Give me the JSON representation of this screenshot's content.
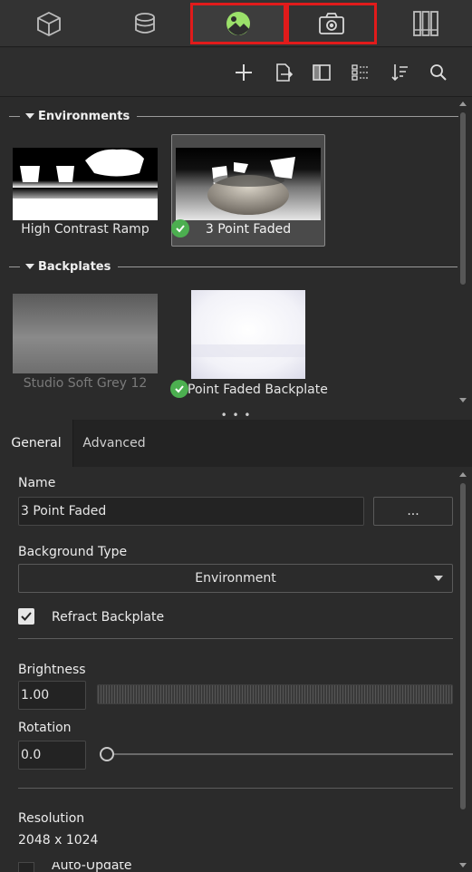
{
  "top_tabs": [
    {
      "icon": "cube-icon"
    },
    {
      "icon": "material-ball-icon"
    },
    {
      "icon": "environment-icon",
      "active": true
    },
    {
      "icon": "camera-icon"
    },
    {
      "icon": "library-books-icon"
    }
  ],
  "toolbar": {
    "icons": [
      "plus-icon",
      "import-file-icon",
      "split-view-icon",
      "grid-view-icon",
      "sort-icon",
      "search-icon"
    ]
  },
  "library": {
    "environments": {
      "header": "Environments",
      "items": [
        {
          "label": "High Contrast Ramp",
          "selected": false,
          "active": false
        },
        {
          "label": "3 Point Faded",
          "selected": true,
          "active": true
        }
      ]
    },
    "backplates": {
      "header": "Backplates",
      "items": [
        {
          "label": "Studio Soft Grey 12",
          "dimmed": true,
          "active": false
        },
        {
          "label": "Point Faded Backplate",
          "dimmed": false,
          "active": true
        }
      ]
    }
  },
  "splitter": {
    "glyph": "• • •"
  },
  "properties": {
    "tabs": [
      {
        "label": "General",
        "active": true
      },
      {
        "label": "Advanced",
        "active": false
      }
    ],
    "name_label": "Name",
    "name_value": "3 Point Faded",
    "browse_button": "...",
    "background_type_label": "Background Type",
    "background_type_value": "Environment",
    "refract_backplate_label": "Refract Backplate",
    "refract_backplate_checked": true,
    "brightness_label": "Brightness",
    "brightness_value": "1.00",
    "rotation_label": "Rotation",
    "rotation_value": "0.0",
    "rotation_slider_fraction": 0,
    "resolution_label": "Resolution",
    "resolution_value": "2048 x 1024",
    "auto_update_label": "Auto-Update"
  },
  "colors": {
    "highlight_box": "#e11b1b",
    "active_icon": "#9be06a",
    "check": "#4caf50"
  }
}
